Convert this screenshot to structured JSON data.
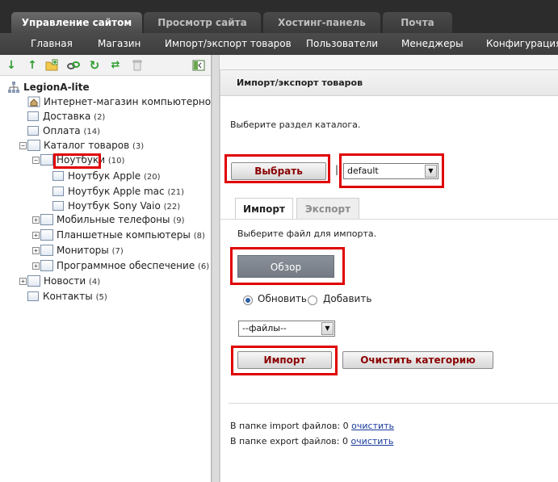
{
  "top_tabs": [
    {
      "label": "Управление сайтом",
      "active": true
    },
    {
      "label": "Просмотр сайта",
      "active": false
    },
    {
      "label": "Хостинг-панель",
      "active": false
    },
    {
      "label": "Почта",
      "active": false
    }
  ],
  "menu": [
    "Главная",
    "Магазин",
    "Импорт/экспорт товаров",
    "Пользователи",
    "Менеджеры",
    "Конфигурация"
  ],
  "toolbar_icons": [
    "arrow-down-icon",
    "arrow-up-icon",
    "add-folder-icon",
    "link-icon",
    "refresh-icon",
    "shuffle-icon",
    "trash-icon",
    "collapse-panel-icon"
  ],
  "tree": {
    "root": "LegionA-lite",
    "items": [
      {
        "label": "Интернет-магазин компьютерной те",
        "count": ""
      },
      {
        "label": "Доставка",
        "count": "(2)"
      },
      {
        "label": "Оплата",
        "count": "(14)"
      },
      {
        "label": "Каталог товаров",
        "count": "(3)"
      },
      {
        "label": "Ноутбуки",
        "count": "(10)"
      },
      {
        "label": "Ноутбук Apple",
        "count": "(20)"
      },
      {
        "label": "Ноутбук Apple mac",
        "count": "(21)"
      },
      {
        "label": "Ноутбук Sony Vaio",
        "count": "(22)"
      },
      {
        "label": "Мобильные телефоны",
        "count": "(9)"
      },
      {
        "label": "Планшетные компьютеры",
        "count": "(8)"
      },
      {
        "label": "Мониторы",
        "count": "(7)"
      },
      {
        "label": "Программное обеспечение",
        "count": "(6)"
      },
      {
        "label": "Новости",
        "count": "(4)"
      },
      {
        "label": "Контакты",
        "count": "(5)"
      }
    ]
  },
  "panel": {
    "title": "Импорт/экспорт товаров",
    "choose_section_text": "Выберите раздел каталога.",
    "select_button": "Выбрать",
    "separator": "|",
    "catalog_select_value": "default",
    "tabs": [
      "Импорт",
      "Экспорт"
    ],
    "choose_file_text": "Выберите файл для импорта.",
    "browse_button": "Обзор",
    "radio_update": "Обновить",
    "radio_add": "Добавить",
    "files_select_value": "--файлы--",
    "import_button": "Импорт",
    "clear_button": "Очистить категорию",
    "import_folder_text": "В папке import файлов: 0",
    "export_folder_text": "В папке export файлов: 0",
    "clear_link": "очистить"
  },
  "colors": {
    "highlight": "#e00000",
    "accent_text": "#8a0000",
    "link": "#1a3c9c"
  }
}
